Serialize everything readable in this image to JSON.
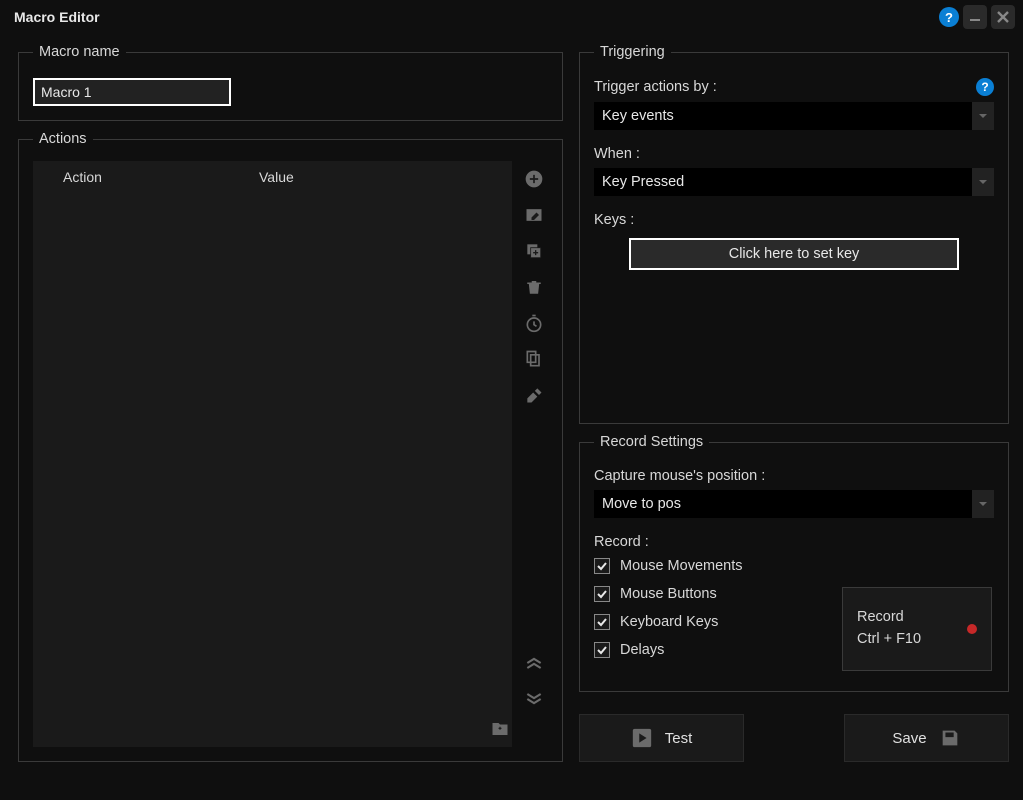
{
  "titlebar": {
    "title": "Macro Editor"
  },
  "macro_name": {
    "legend": "Macro name",
    "value": "Macro 1"
  },
  "actions": {
    "legend": "Actions",
    "header_action": "Action",
    "header_value": "Value"
  },
  "triggering": {
    "legend": "Triggering",
    "trigger_label": "Trigger actions by :",
    "trigger_value": "Key events",
    "when_label": "When :",
    "when_value": "Key Pressed",
    "keys_label": "Keys :",
    "set_key_label": "Click here to set key"
  },
  "record_settings": {
    "legend": "Record Settings",
    "capture_label": "Capture mouse's position :",
    "capture_value": "Move to pos",
    "record_label": "Record :",
    "checkboxes": {
      "mouse_movements": "Mouse Movements",
      "mouse_buttons": "Mouse Buttons",
      "keyboard_keys": "Keyboard Keys",
      "delays": "Delays"
    },
    "record_button_line1": "Record",
    "record_button_line2": "Ctrl + F10"
  },
  "buttons": {
    "test": "Test",
    "save": "Save"
  }
}
